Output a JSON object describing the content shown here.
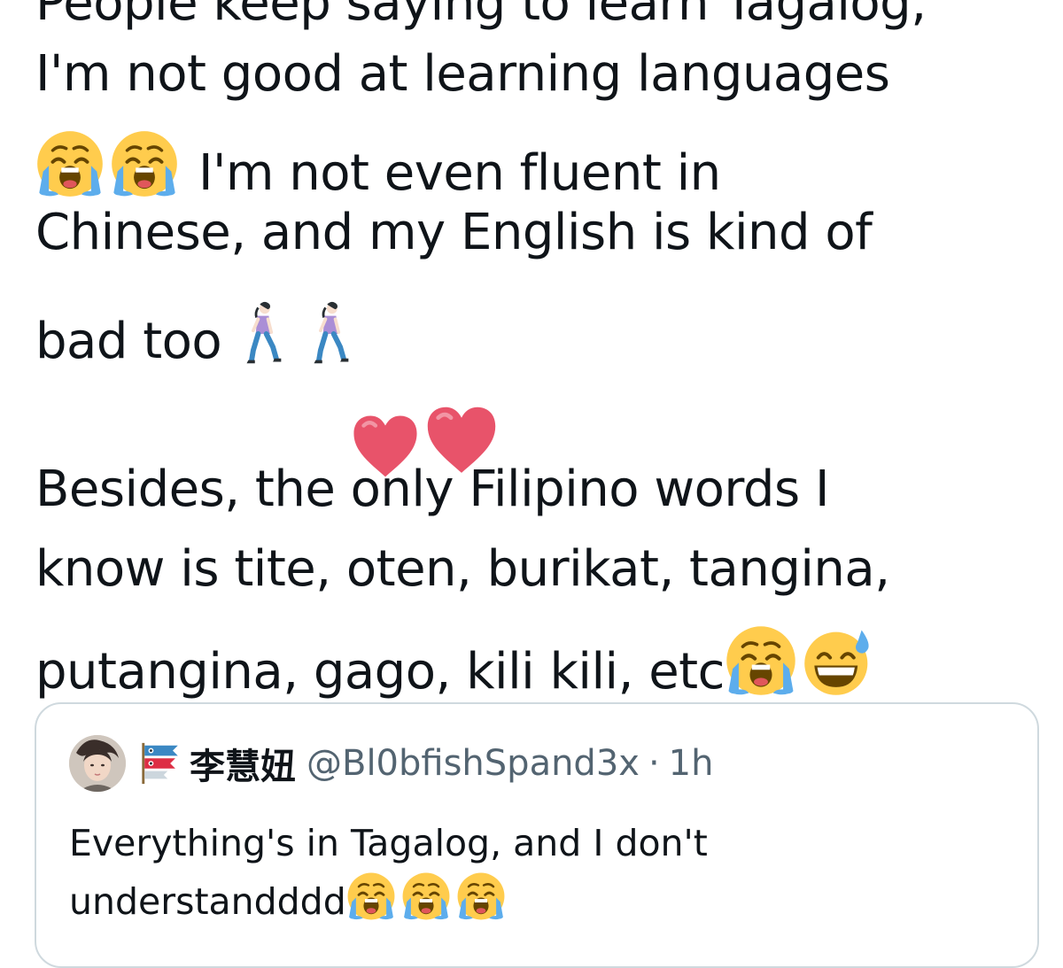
{
  "tweet": {
    "lines": [
      "People keep saying to learn Tagalog,",
      "I'm not good at learning languages",
      "I'm not even fluent in",
      "Chinese, and my English is kind of",
      "bad too",
      "Besides, the only Filipino words I",
      "know is tite, oten, burikat, tangina,",
      "putangina, gago, kili kili, etc"
    ],
    "emoji_names": [
      "loudly-crying-face",
      "woman-walking",
      "red-heart",
      "grinning-face-with-sweat"
    ]
  },
  "quote": {
    "display_name": "李慧妞",
    "handle": "@Bl0bfishSpand3x",
    "separator": "·",
    "time": "1h",
    "text_lines": [
      "Everything's in Tagalog, and I don't",
      "understandddd"
    ]
  },
  "colors": {
    "text": "#0f1419",
    "secondary_text": "#536471",
    "border": "#cfd9de",
    "emoji_yellow": "#ffcc4d",
    "heart_red": "#dd2e44"
  }
}
